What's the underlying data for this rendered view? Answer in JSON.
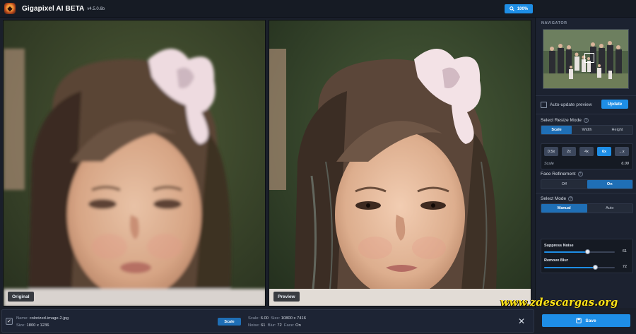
{
  "app": {
    "title": "Gigapixel AI BETA",
    "version": "v4.5.0.6b",
    "zoom": "100%"
  },
  "panes": {
    "left_label": "Original",
    "right_label": "Preview"
  },
  "sidebar": {
    "navigator_title": "NAVIGATOR",
    "auto_update_label": "Auto-update preview",
    "update_button": "Update",
    "resize_mode_title": "Select Resize Mode",
    "resize_modes": [
      "Scale",
      "Width",
      "Height"
    ],
    "resize_mode_selected": "Scale",
    "scale_options": [
      "0.5x",
      "2x",
      "4x",
      "6x",
      "...x"
    ],
    "scale_selected": "6x",
    "scale_caption": "Scale",
    "scale_value": "6.00",
    "face_refinement_title": "Face Refinement",
    "face_options": [
      "Off",
      "On"
    ],
    "face_selected": "On",
    "mode_title": "Select Mode",
    "mode_options": [
      "Manual",
      "Auto"
    ],
    "mode_selected": "Manual",
    "suppress_noise_label": "Suppress Noise",
    "suppress_noise_value": "61",
    "remove_blur_label": "Remove Blur",
    "remove_blur_value": "72",
    "suppress_noise_level": 0.61,
    "remove_blur_level": 0.72
  },
  "bottom": {
    "name_key": "Name:",
    "name_value": "colorized-image-2.jpg",
    "size_key": "Size:",
    "size_value": "1800 x 1236",
    "mode_chip": "Scale",
    "scale_key": "Scale:",
    "scale_value": "6.00",
    "out_size_key": "Size:",
    "out_size_value": "10800 x 7416",
    "noise_key": "Noise:",
    "noise_value": "61",
    "blur_key": "Blur:",
    "blur_value": "72",
    "face_key": "Face:",
    "face_value": "On",
    "save_label": "Save",
    "close_glyph": "✕"
  },
  "watermark": "www.zdescargas.org",
  "colors": {
    "accent": "#1e8ee6",
    "background": "#1a1f2a",
    "sidebar": "#1c2230",
    "watermark": "#ffe51a"
  }
}
